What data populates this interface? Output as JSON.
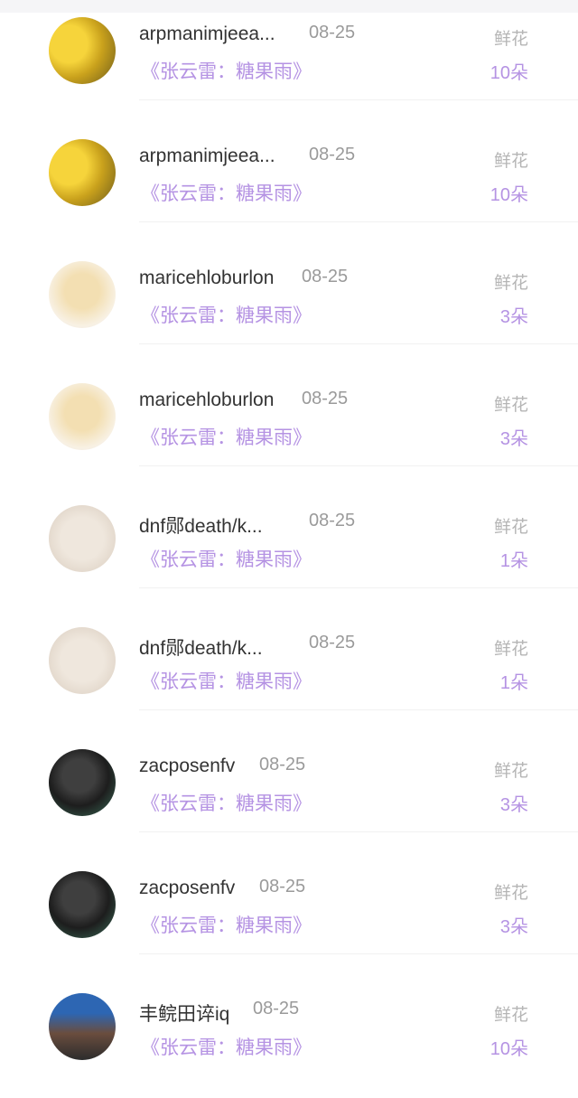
{
  "items": [
    {
      "username": "arpmanimjeea...",
      "date": "08-25",
      "work": "《张云雷：糖果雨》",
      "gift": "鲜花",
      "count": "10朵",
      "avatar": "yellow"
    },
    {
      "username": "arpmanimjeea...",
      "date": "08-25",
      "work": "《张云雷：糖果雨》",
      "gift": "鲜花",
      "count": "10朵",
      "avatar": "yellow"
    },
    {
      "username": "maricehloburlon",
      "date": "08-25",
      "work": "《张云雷：糖果雨》",
      "gift": "鲜花",
      "count": "3朵",
      "avatar": "anime"
    },
    {
      "username": "maricehloburlon",
      "date": "08-25",
      "work": "《张云雷：糖果雨》",
      "gift": "鲜花",
      "count": "3朵",
      "avatar": "anime"
    },
    {
      "username": "dnf郧death/k...",
      "date": "08-25",
      "work": "《张云雷：糖果雨》",
      "gift": "鲜花",
      "count": "1朵",
      "avatar": "pale"
    },
    {
      "username": "dnf郧death/k...",
      "date": "08-25",
      "work": "《张云雷：糖果雨》",
      "gift": "鲜花",
      "count": "1朵",
      "avatar": "pale"
    },
    {
      "username": "zacposenfv",
      "date": "08-25",
      "work": "《张云雷：糖果雨》",
      "gift": "鲜花",
      "count": "3朵",
      "avatar": "dark"
    },
    {
      "username": "zacposenfv",
      "date": "08-25",
      "work": "《张云雷：糖果雨》",
      "gift": "鲜花",
      "count": "3朵",
      "avatar": "dark"
    },
    {
      "username": "丰鲩田谇iq",
      "date": "08-25",
      "work": "《张云雷：糖果雨》",
      "gift": "鲜花",
      "count": "10朵",
      "avatar": "city"
    }
  ]
}
